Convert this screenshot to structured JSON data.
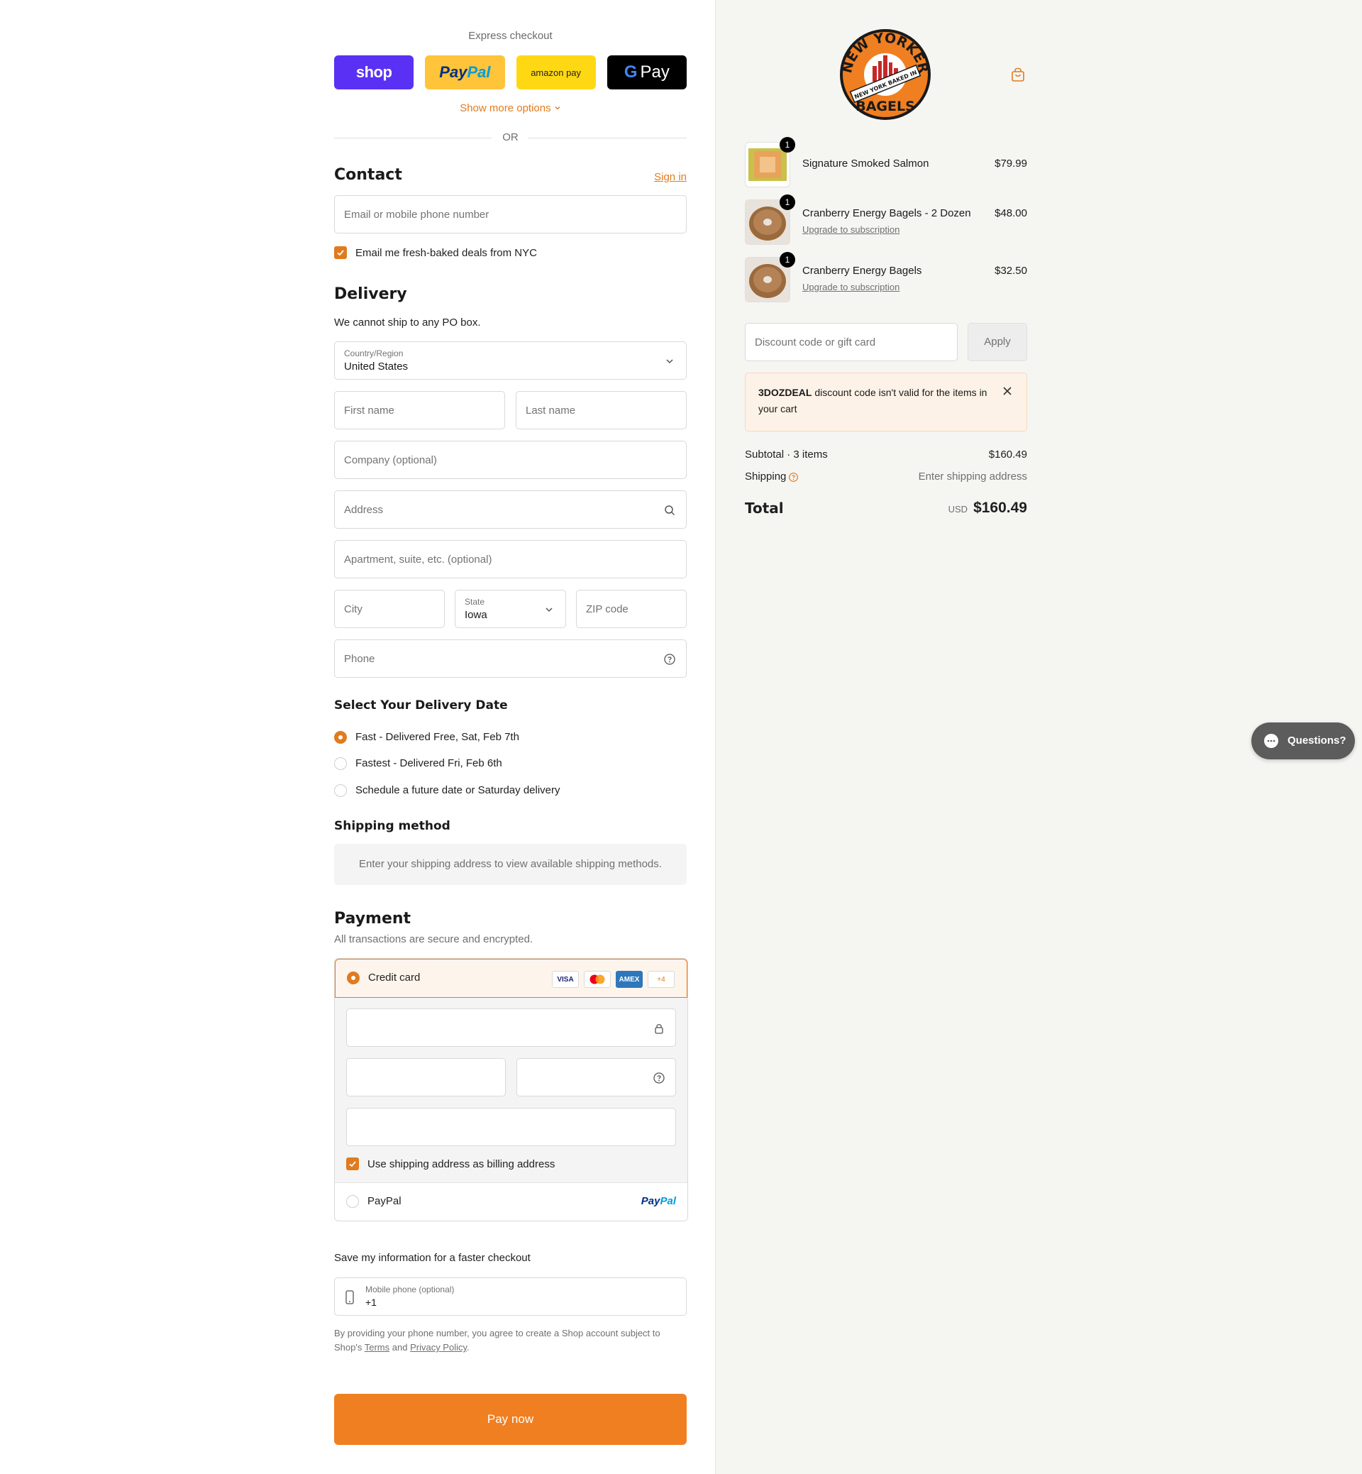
{
  "express": {
    "title": "Express checkout",
    "buttons": [
      "shop",
      "Pay",
      "Pal",
      "amazon pay",
      "G",
      "Pay"
    ],
    "more_options": "Show more options",
    "or": "OR"
  },
  "contact": {
    "heading": "Contact",
    "sign_in": "Sign in",
    "email_placeholder": "Email or mobile phone number",
    "newsletter_label": "Email me fresh-baked deals from NYC"
  },
  "delivery": {
    "heading": "Delivery",
    "note": "We cannot ship to any PO box.",
    "country_label": "Country/Region",
    "country_value": "United States",
    "first_name": "First name",
    "last_name": "Last name",
    "company": "Company (optional)",
    "address": "Address",
    "apartment": "Apartment, suite, etc. (optional)",
    "city": "City",
    "state_label": "State",
    "state_value": "Iowa",
    "zip": "ZIP code",
    "phone": "Phone"
  },
  "delivery_date": {
    "heading": "Select Your Delivery Date",
    "options": [
      {
        "label": "Fast - Delivered Free, Sat, Feb 7th",
        "selected": true
      },
      {
        "label": "Fastest - Delivered Fri, Feb 6th",
        "selected": false
      },
      {
        "label": "Schedule a future date or Saturday delivery",
        "selected": false
      }
    ]
  },
  "shipping_method": {
    "heading": "Shipping method",
    "notice": "Enter your shipping address to view available shipping methods."
  },
  "payment": {
    "heading": "Payment",
    "subtitle": "All transactions are secure and encrypted.",
    "credit_card_label": "Credit card",
    "card_logos": [
      "VISA",
      "MC",
      "AMEX",
      "+4"
    ],
    "billing_label": "Use shipping address as billing address",
    "paypal_label": "PayPal",
    "paypal_logo": [
      "Pay",
      "Pal"
    ]
  },
  "save_info": {
    "heading": "Save my information for a faster checkout",
    "mobile_label": "Mobile phone (optional)",
    "mobile_value": "+1",
    "legal_prefix": "By providing your phone number, you agree to create a Shop account subject to Shop's",
    "terms": "Terms",
    "and": "and",
    "privacy": "Privacy Policy",
    "period": "."
  },
  "pay_now": "Pay now",
  "brand": {
    "logo_text_top": "NEW YORKER",
    "logo_text_bottom": "BAGELS",
    "logo_banner": "NEW YORK BAKED IN",
    "accent": "#e07b1f",
    "button_orange": "#f07f21"
  },
  "cart": {
    "items": [
      {
        "name": "Signature Smoked Salmon",
        "price": "$79.99",
        "qty": "1",
        "sub": ""
      },
      {
        "name": "Cranberry Energy Bagels - 2 Dozen",
        "price": "$48.00",
        "qty": "1",
        "sub": "Upgrade to subscription"
      },
      {
        "name": "Cranberry Energy Bagels",
        "price": "$32.50",
        "qty": "1",
        "sub": "Upgrade to subscription"
      }
    ],
    "discount_placeholder": "Discount code or gift card",
    "apply": "Apply",
    "alert_code": "3DOZDEAL",
    "alert_text": " discount code isn't valid for the items in your cart",
    "subtotal_label": "Subtotal · 3 items",
    "subtotal_value": "$160.49",
    "shipping_label": "Shipping",
    "shipping_value": "Enter shipping address",
    "total_label": "Total",
    "currency": "USD",
    "total_value": "$160.49"
  },
  "chat": {
    "label": "Questions?"
  }
}
